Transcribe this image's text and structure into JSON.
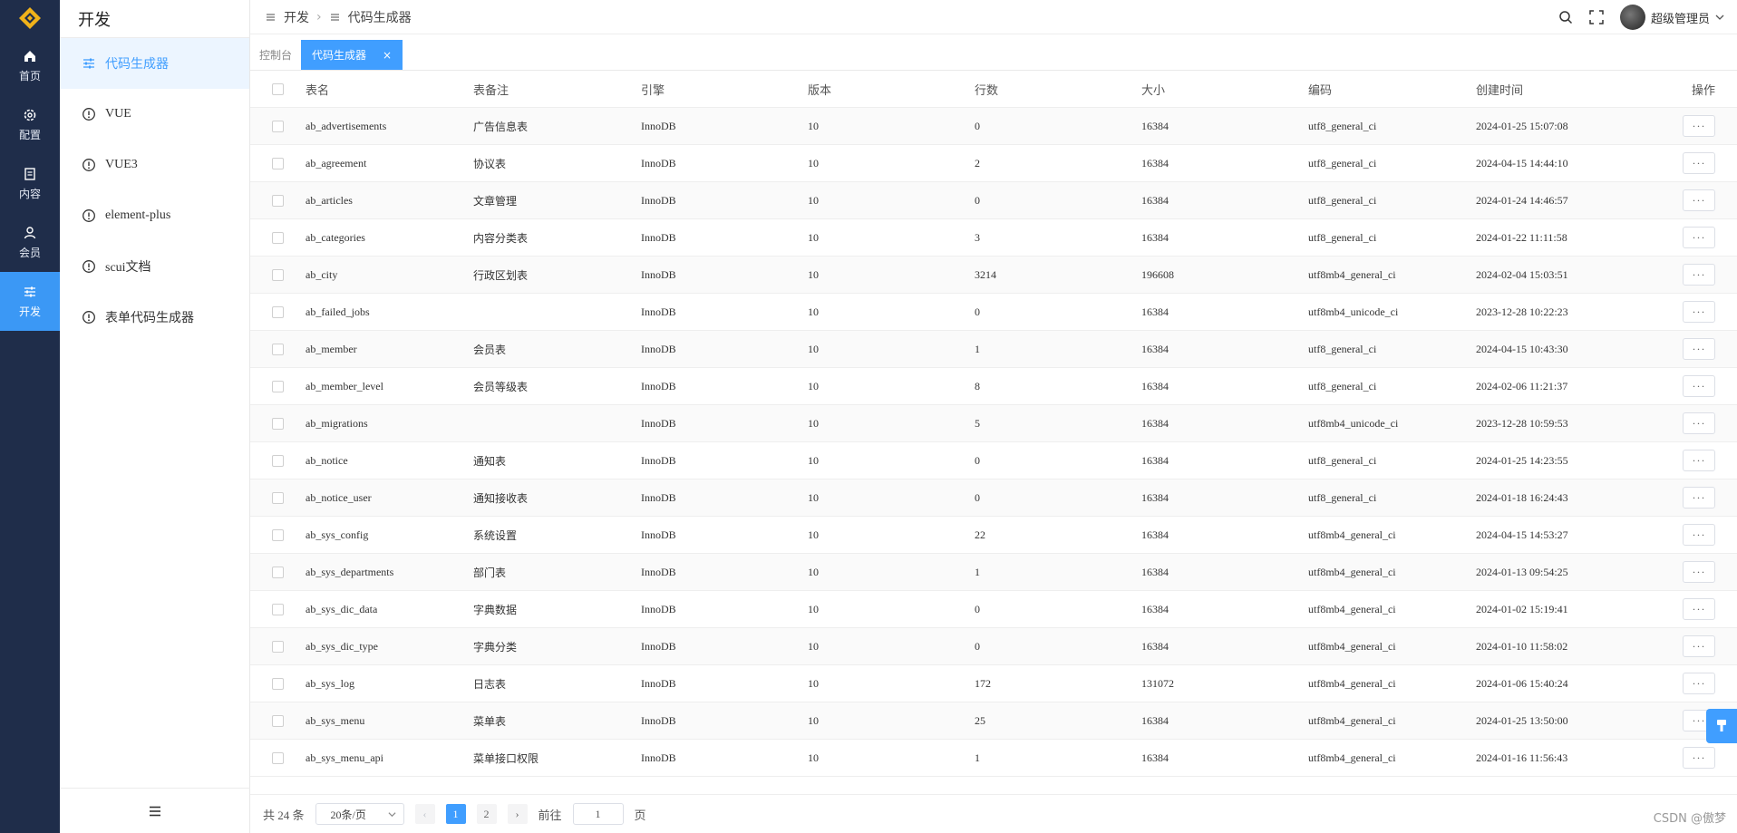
{
  "rail": {
    "items": [
      {
        "label": "首页",
        "icon": "home-icon"
      },
      {
        "label": "配置",
        "icon": "gear-icon"
      },
      {
        "label": "内容",
        "icon": "document-icon"
      },
      {
        "label": "会员",
        "icon": "user-icon"
      },
      {
        "label": "开发",
        "icon": "sliders-icon",
        "active": true
      }
    ]
  },
  "sidebar": {
    "title": "开发",
    "items": [
      {
        "label": "代码生成器",
        "active": true
      },
      {
        "label": "VUE"
      },
      {
        "label": "VUE3"
      },
      {
        "label": "element-plus"
      },
      {
        "label": "scui文档"
      },
      {
        "label": "表单代码生成器"
      }
    ]
  },
  "header": {
    "breadcrumb": [
      "开发",
      "代码生成器"
    ],
    "username": "超级管理员"
  },
  "tabs": {
    "console": "控制台",
    "active": "代码生成器"
  },
  "table": {
    "columns": [
      "表名",
      "表备注",
      "引擎",
      "版本",
      "行数",
      "大小",
      "编码",
      "创建时间",
      "操作"
    ],
    "rows": [
      [
        "ab_advertisements",
        "广告信息表",
        "InnoDB",
        "10",
        "0",
        "16384",
        "utf8_general_ci",
        "2024-01-25 15:07:08"
      ],
      [
        "ab_agreement",
        "协议表",
        "InnoDB",
        "10",
        "2",
        "16384",
        "utf8_general_ci",
        "2024-04-15 14:44:10"
      ],
      [
        "ab_articles",
        "文章管理",
        "InnoDB",
        "10",
        "0",
        "16384",
        "utf8_general_ci",
        "2024-01-24 14:46:57"
      ],
      [
        "ab_categories",
        "内容分类表",
        "InnoDB",
        "10",
        "3",
        "16384",
        "utf8_general_ci",
        "2024-01-22 11:11:58"
      ],
      [
        "ab_city",
        "行政区划表",
        "InnoDB",
        "10",
        "3214",
        "196608",
        "utf8mb4_general_ci",
        "2024-02-04 15:03:51"
      ],
      [
        "ab_failed_jobs",
        "",
        "InnoDB",
        "10",
        "0",
        "16384",
        "utf8mb4_unicode_ci",
        "2023-12-28 10:22:23"
      ],
      [
        "ab_member",
        "会员表",
        "InnoDB",
        "10",
        "1",
        "16384",
        "utf8_general_ci",
        "2024-04-15 10:43:30"
      ],
      [
        "ab_member_level",
        "会员等级表",
        "InnoDB",
        "10",
        "8",
        "16384",
        "utf8_general_ci",
        "2024-02-06 11:21:37"
      ],
      [
        "ab_migrations",
        "",
        "InnoDB",
        "10",
        "5",
        "16384",
        "utf8mb4_unicode_ci",
        "2023-12-28 10:59:53"
      ],
      [
        "ab_notice",
        "通知表",
        "InnoDB",
        "10",
        "0",
        "16384",
        "utf8_general_ci",
        "2024-01-25 14:23:55"
      ],
      [
        "ab_notice_user",
        "通知接收表",
        "InnoDB",
        "10",
        "0",
        "16384",
        "utf8_general_ci",
        "2024-01-18 16:24:43"
      ],
      [
        "ab_sys_config",
        "系统设置",
        "InnoDB",
        "10",
        "22",
        "16384",
        "utf8mb4_general_ci",
        "2024-04-15 14:53:27"
      ],
      [
        "ab_sys_departments",
        "部门表",
        "InnoDB",
        "10",
        "1",
        "16384",
        "utf8mb4_general_ci",
        "2024-01-13 09:54:25"
      ],
      [
        "ab_sys_dic_data",
        "字典数据",
        "InnoDB",
        "10",
        "0",
        "16384",
        "utf8mb4_general_ci",
        "2024-01-02 15:19:41"
      ],
      [
        "ab_sys_dic_type",
        "字典分类",
        "InnoDB",
        "10",
        "0",
        "16384",
        "utf8mb4_general_ci",
        "2024-01-10 11:58:02"
      ],
      [
        "ab_sys_log",
        "日志表",
        "InnoDB",
        "10",
        "172",
        "131072",
        "utf8mb4_general_ci",
        "2024-01-06 15:40:24"
      ],
      [
        "ab_sys_menu",
        "菜单表",
        "InnoDB",
        "10",
        "25",
        "16384",
        "utf8mb4_general_ci",
        "2024-01-25 13:50:00"
      ],
      [
        "ab_sys_menu_api",
        "菜单接口权限",
        "InnoDB",
        "10",
        "1",
        "16384",
        "utf8mb4_general_ci",
        "2024-01-16 11:56:43"
      ]
    ],
    "op_label": "···"
  },
  "pager": {
    "total": "共 24 条",
    "page_size": "20条/页",
    "pages": [
      "1",
      "2"
    ],
    "goto_label": "前往",
    "goto_value": "1",
    "page_unit": "页"
  },
  "watermark": "CSDN @傲梦",
  "colors": {
    "rail_bg": "#1f2d4a",
    "accent": "#409eff",
    "logo": "#f0b21a"
  }
}
